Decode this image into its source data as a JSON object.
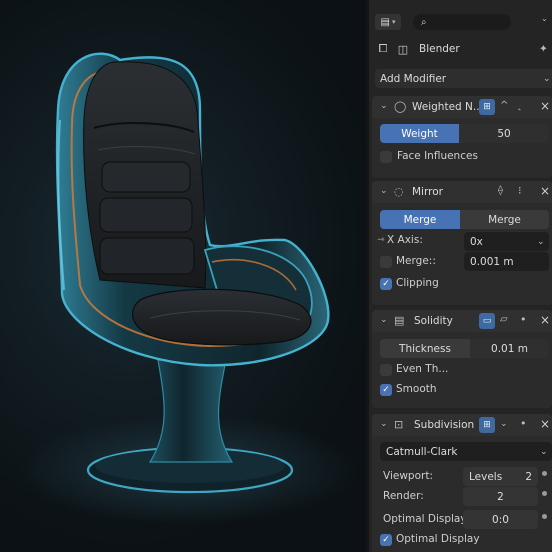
{
  "header": {
    "search_placeholder": "",
    "object_name": "Blender",
    "add_modifier_label": "Add Modifier"
  },
  "modifiers": {
    "weighted": {
      "title": "Weighted N...",
      "weight_label": "Weight",
      "weight_value": "50",
      "face_influence_label": "Face Influences",
      "face_influence_checked": false
    },
    "mirror": {
      "title": "Mirror",
      "merge_tab_1": "Merge",
      "merge_tab_2": "Merge",
      "x_axis_label": "X Axis:",
      "x_axis_value": "0x",
      "merge_label": "Merge::",
      "merge_value": "0.001 m",
      "merge_checked": false,
      "clipping_label": "Clipping",
      "clipping_checked": true
    },
    "solidify": {
      "title": "Solidity",
      "thickness_label": "Thickness",
      "thickness_value": "0.01 m",
      "even_label": "Even Th...",
      "even_checked": false,
      "smooth_label": "Smooth",
      "smooth_checked": true
    },
    "subdivision": {
      "title": "Subdivision",
      "method_value": "Catmull-Clark",
      "viewport_label": "Viewport:",
      "levels_label": "Levels",
      "levels_value": "2",
      "render_label": "Render:",
      "render_value": "2",
      "optimal_display_label": "Optimal Display:",
      "optimal_display_value": "0:0",
      "optimal_display_check_label": "Optimal Display",
      "optimal_display_checked": true
    }
  },
  "colors": {
    "accent": "#4772b3",
    "panel_bg": "#242424",
    "viewport_bg": "#121d23",
    "chair_rim": "#3fa7c4",
    "chair_glow": "#d07a3a"
  }
}
